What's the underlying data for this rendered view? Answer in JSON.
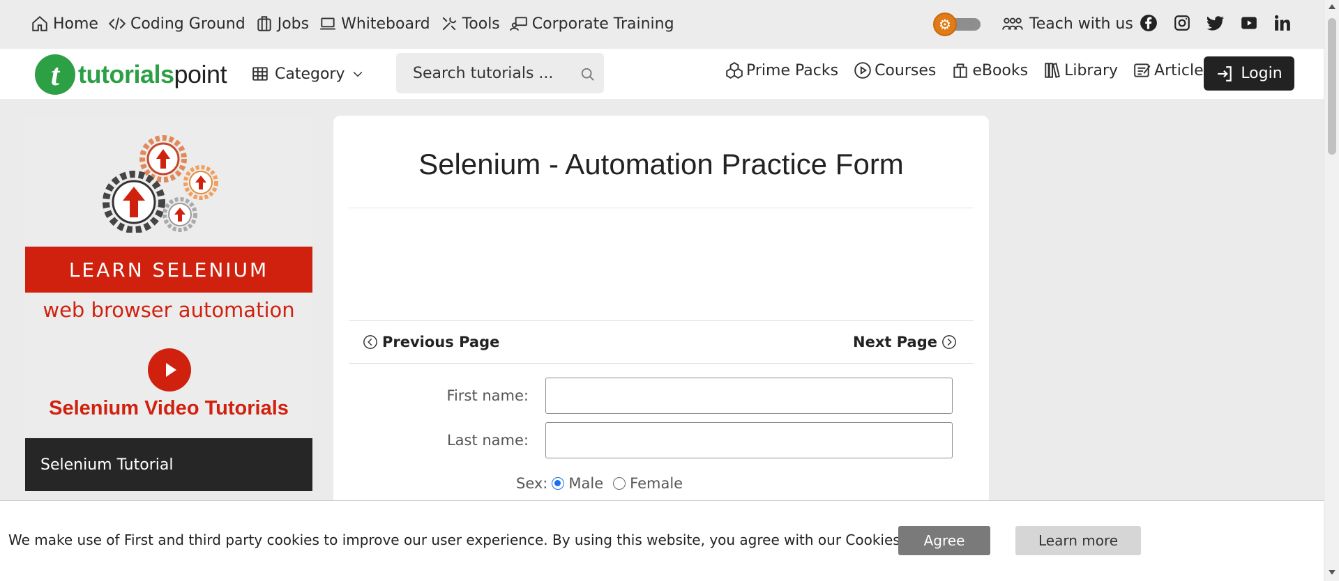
{
  "topnav": {
    "items": [
      {
        "label": "Home",
        "icon": "home-icon"
      },
      {
        "label": "Coding Ground",
        "icon": "code-icon"
      },
      {
        "label": "Jobs",
        "icon": "briefcase-icon"
      },
      {
        "label": "Whiteboard",
        "icon": "laptop-icon"
      },
      {
        "label": "Tools",
        "icon": "tools-icon"
      },
      {
        "label": "Corporate Training",
        "icon": "training-icon"
      }
    ],
    "teach_label": "Teach with us",
    "socials": [
      "facebook-icon",
      "instagram-icon",
      "twitter-icon",
      "youtube-icon",
      "linkedin-icon"
    ]
  },
  "header": {
    "logo_part1": "tutorials",
    "logo_part2": "point",
    "category_label": "Category",
    "search_placeholder": "Search tutorials ...",
    "nav": [
      {
        "label": "Prime Packs",
        "icon": "cubes-icon"
      },
      {
        "label": "Courses",
        "icon": "play-circle-icon"
      },
      {
        "label": "eBooks",
        "icon": "book-open-icon"
      },
      {
        "label": "Library",
        "icon": "library-icon"
      },
      {
        "label": "Articles",
        "icon": "article-icon"
      }
    ],
    "login_label": "Login"
  },
  "sidebar": {
    "ad_title": "LEARN SELENIUM",
    "ad_subtitle": "web browser automation",
    "ad_video": "Selenium Video Tutorials",
    "menu_item": "Selenium Tutorial"
  },
  "content": {
    "title": "Selenium - Automation Practice Form",
    "prev_label": "Previous Page",
    "next_label": "Next Page",
    "first_name_label": "First name:",
    "last_name_label": "Last name:",
    "sex_label": "Sex:",
    "sex_options": [
      "Male",
      "Female"
    ],
    "sex_selected": "Male"
  },
  "cookie": {
    "message": "We make use of First and third party cookies to improve our user experience. By using this website, you agree with our Cookies Policy.",
    "agree_label": "Agree",
    "learn_label": "Learn more"
  },
  "colors": {
    "brand_green": "#2d9f45",
    "accent_red": "#d0210e",
    "toggle_orange": "#e07b18",
    "dark": "#222222"
  }
}
